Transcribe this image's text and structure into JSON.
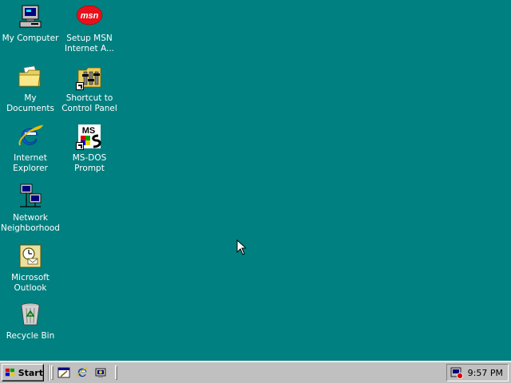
{
  "desktop": {
    "background_color": "#008080",
    "icons": [
      {
        "label": "My Computer",
        "icon": "my-computer-icon"
      },
      {
        "label": "Setup MSN\nInternet A...",
        "icon": "msn-icon"
      },
      {
        "label": "My Documents",
        "icon": "folder-icon"
      },
      {
        "label": "Shortcut to\nControl Panel",
        "icon": "control-panel-icon"
      },
      {
        "label": "Internet\nExplorer",
        "icon": "internet-explorer-icon"
      },
      {
        "label": "MS-DOS\nPrompt",
        "icon": "ms-dos-icon"
      },
      {
        "label": "Network\nNeighborhood",
        "icon": "network-icon"
      },
      {
        "label": "Microsoft\nOutlook",
        "icon": "outlook-icon"
      },
      {
        "label": "Recycle Bin",
        "icon": "recycle-bin-icon"
      }
    ],
    "msn_text": "msn",
    "msdos_text": "MS"
  },
  "taskbar": {
    "start_label": "Start",
    "quick_launch": [
      "show-desktop-icon",
      "internet-explorer-icon",
      "channels-icon"
    ],
    "tray": {
      "icon": "volume-icon",
      "clock": "9:57 PM"
    }
  }
}
